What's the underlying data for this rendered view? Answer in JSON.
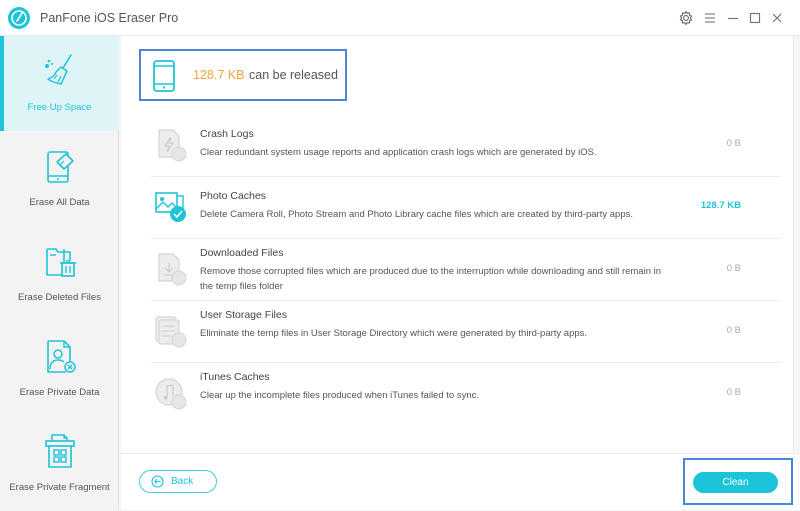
{
  "window": {
    "title": "PanFone iOS Eraser Pro",
    "controls": [
      {
        "name": "settings",
        "icon": "gear-icon"
      },
      {
        "name": "menu",
        "icon": "hamburger-menu-icon"
      },
      {
        "name": "minimize",
        "icon": "minimize-icon"
      },
      {
        "name": "maximize",
        "icon": "maximize-icon"
      },
      {
        "name": "close",
        "icon": "close-icon"
      }
    ]
  },
  "colors": {
    "accent": "#1fc4d8",
    "highlight_orange": "#f4a23c",
    "active_bg": "#dff4f7",
    "focus_border": "#4a86d8"
  },
  "sidebar": {
    "items": [
      {
        "label": "Free Up Space",
        "icon": "broom-icon",
        "active": true
      },
      {
        "label": "Erase All Data",
        "icon": "phone-eraser-icon",
        "active": false
      },
      {
        "label": "Erase Deleted Files",
        "icon": "folder-trash-icon",
        "active": false
      },
      {
        "label": "Erase Private Data",
        "icon": "user-file-x-icon",
        "active": false
      },
      {
        "label": "Erase Private Fragment",
        "icon": "fragment-grid-icon",
        "active": false
      }
    ]
  },
  "summary": {
    "size": "128.7 KB",
    "text": "can be released",
    "icon": "tablet-icon"
  },
  "items": [
    {
      "title": "Crash Logs",
      "description": "Clear redundant system usage reports and application crash logs which are generated by iOS.",
      "size": "0 B",
      "icon": "crash-log-icon",
      "active": false
    },
    {
      "title": "Photo Caches",
      "description": "Delete Camera Roll, Photo Stream and Photo Library cache files which are created by third-party apps.",
      "size": "128.7 KB",
      "icon": "photo-check-icon",
      "active": true
    },
    {
      "title": "Downloaded Files",
      "description": "Remove those corrupted files which are produced due to the interruption while downloading and still remain in the temp files folder",
      "size": "0 B",
      "icon": "download-file-icon",
      "active": false
    },
    {
      "title": "User Storage Files",
      "description": "Eliminate the temp files in User Storage Directory which were generated by third-party apps.",
      "size": "0 B",
      "icon": "storage-files-icon",
      "active": false
    },
    {
      "title": "iTunes Caches",
      "description": "Clear up the incomplete files produced when iTunes failed to sync.",
      "size": "0 B",
      "icon": "music-note-icon",
      "active": false
    }
  ],
  "footer": {
    "back_label": "Back",
    "clean_label": "Clean"
  }
}
